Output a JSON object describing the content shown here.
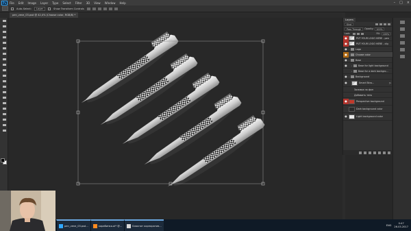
{
  "menubar": {
    "app_logo": "Ps",
    "items": [
      "File",
      "Edit",
      "Image",
      "Layer",
      "Type",
      "Select",
      "Filter",
      "3D",
      "View",
      "Window",
      "Help"
    ],
    "window_controls": [
      "–",
      "□",
      "×"
    ]
  },
  "options_bar": {
    "auto_select_label": "Auto-Select:",
    "auto_select_value": "Layer",
    "show_transform_label": "Show Transform Controls"
  },
  "document_tab": {
    "title": "pen_vene_03.psd @ 42,4% (Choose color, RGB/8) *"
  },
  "layers_panel": {
    "tab_label": "Layers",
    "kind_filter": "Kind",
    "blend_mode": "Pass Through",
    "opacity_label": "Opacity:",
    "opacity_value": "100%",
    "lock_label": "Lock:",
    "fill_label": "Fill:",
    "fill_value": "100%",
    "layers": [
      {
        "name": "PUT YOUR LOGO HERE - pen",
        "eye": "red",
        "indent": 0,
        "kind": "smart"
      },
      {
        "name": "PUT YOUR LOGO HERE - clip",
        "eye": "red",
        "indent": 0,
        "kind": "smart"
      },
      {
        "name": "Logo",
        "eye": "normal",
        "indent": 0,
        "kind": "folder"
      },
      {
        "name": "Choose color",
        "eye": "orange",
        "indent": 0,
        "kind": "folder",
        "selected": true
      },
      {
        "name": "Base",
        "eye": "normal",
        "indent": 0,
        "kind": "folder"
      },
      {
        "name": "Base for light background",
        "eye": "normal",
        "indent": 1,
        "kind": "folder"
      },
      {
        "name": "Base for a dark backgro...",
        "eye": "empty",
        "indent": 1,
        "kind": "folder"
      },
      {
        "name": "Background",
        "eye": "normal",
        "indent": 0,
        "kind": "folder"
      },
      {
        "name": "Smart Bkro...",
        "eye": "normal",
        "indent": 1,
        "kind": "smart",
        "tall": true
      },
      {
        "name": "Заливка за фон",
        "eye": "empty",
        "indent": 2,
        "kind": "text"
      },
      {
        "name": "Добавить тень",
        "eye": "empty",
        "indent": 2,
        "kind": "text"
      },
      {
        "name": "Perspective background",
        "eye": "red",
        "indent": 0,
        "kind": "red",
        "tall": true
      },
      {
        "name": "Dark background color",
        "eye": "empty",
        "indent": 0,
        "kind": "dark",
        "tall": true
      },
      {
        "name": "Light background color",
        "eye": "normal",
        "indent": 0,
        "kind": "light",
        "tall": true
      }
    ]
  },
  "taskbar": {
    "items": [
      {
        "label": "pen_vene_03.psd...",
        "icon": "photoshop"
      },
      {
        "label": "карабинка.ai* @...",
        "icon": "illustrator"
      },
      {
        "label": "Блокнот корпоратив...",
        "icon": "document"
      }
    ],
    "language": "ENG",
    "time": "0:47",
    "date": "26.03.2017"
  },
  "canvas": {
    "pen_count": 5,
    "pen_color": "#d8d8d8",
    "pattern": "checkerboard",
    "background": "#282828"
  },
  "colors": {
    "menubar": "#3c3c3c",
    "panel": "#323232",
    "eye_red": "#b2332c",
    "eye_orange": "#b06a14",
    "taskbar": "#0f1a26"
  }
}
